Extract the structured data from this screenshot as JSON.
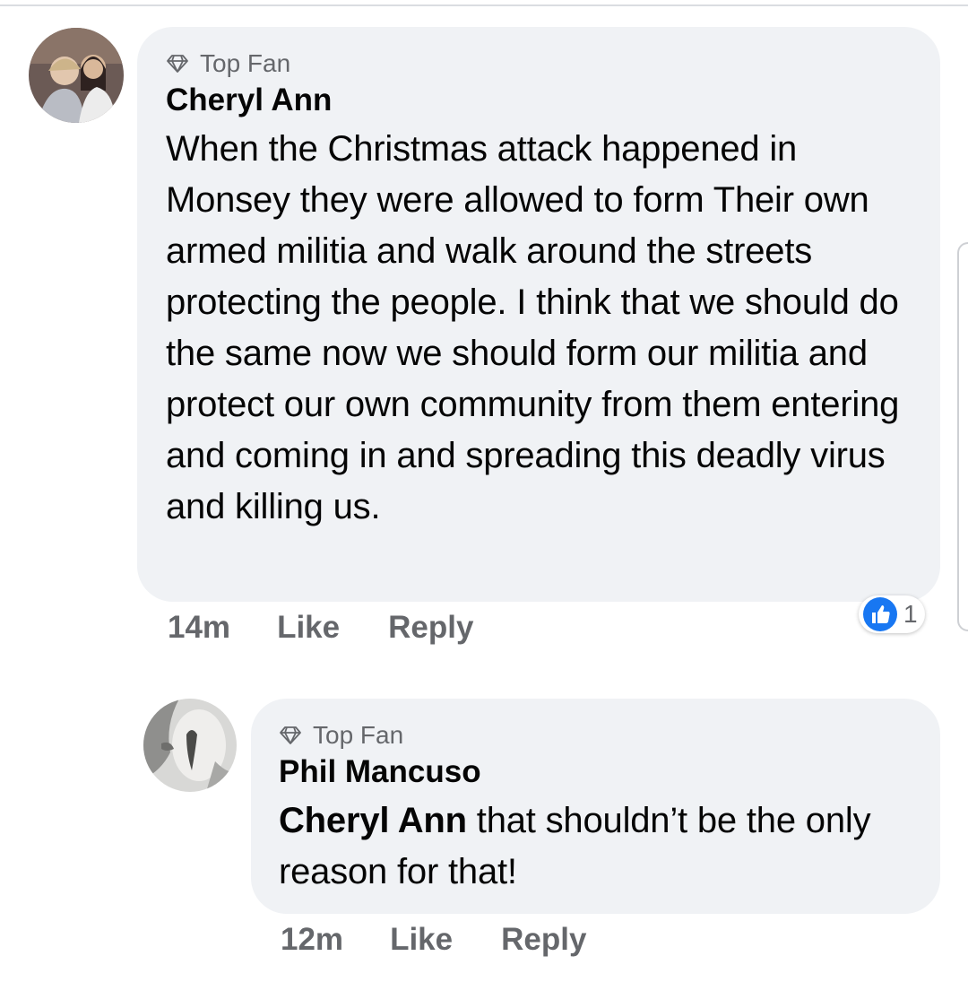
{
  "comments": [
    {
      "badge": "Top Fan",
      "author": "Cheryl Ann",
      "text": "When the Christmas attack happened in Monsey they were allowed to form Their own armed militia and walk around the streets protecting the people. I think that we should do the same now we should form our militia and protect our own community from them entering and coming in and spreading this deadly virus and killing us.",
      "time": "14m",
      "like_label": "Like",
      "reply_label": "Reply",
      "reaction_count": "1"
    },
    {
      "badge": "Top Fan",
      "author": "Phil Mancuso",
      "mention": "Cheryl Ann",
      "text": " that shouldn’t be the only reason for that!",
      "time": "12m",
      "like_label": "Like",
      "reply_label": "Reply"
    }
  ],
  "colors": {
    "bubble": "#f0f2f5",
    "secondary_text": "#65676b",
    "like_blue": "#1877f2"
  }
}
